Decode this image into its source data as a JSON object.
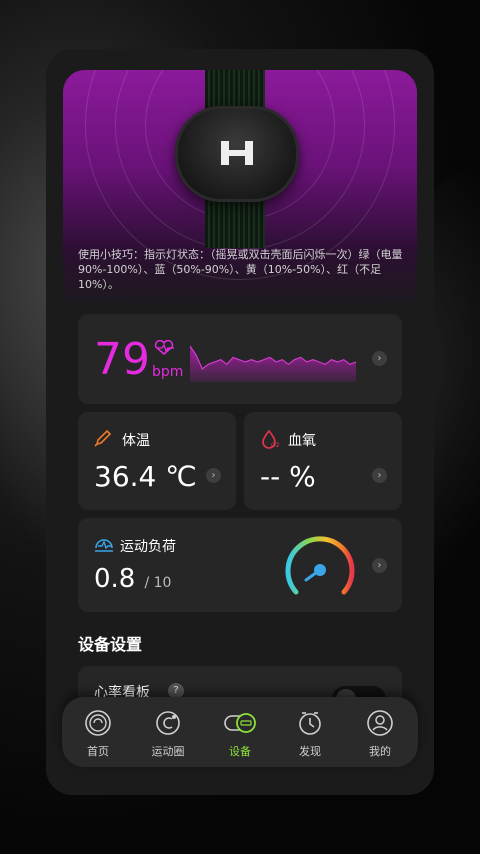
{
  "hero": {
    "tip": "使用小技巧：指示灯状态：（摇晃或双击壳面后闪烁一次）绿（电量90%-100%）、蓝（50%-90%）、黄（10%-50%）、红（不足10%）。"
  },
  "heart_rate": {
    "value": "79",
    "unit": "bpm",
    "color": "#e52be0",
    "trend_values": [
      70,
      66,
      60,
      62,
      63,
      64,
      62,
      65,
      64,
      63,
      64,
      63,
      64,
      65,
      63,
      64,
      62,
      64,
      65,
      63,
      64,
      63,
      62,
      64,
      63,
      64,
      62,
      63
    ]
  },
  "temperature": {
    "label": "体温",
    "value": "36.4 ℃"
  },
  "spo2": {
    "label": "血氧",
    "value": "-- %"
  },
  "training_load": {
    "label": "运动负荷",
    "value": "0.8",
    "max": "/ 10",
    "level": 0.08
  },
  "settings": {
    "section_title": "设备设置",
    "items": [
      {
        "label": "心率看板",
        "help": "?",
        "toggle_on": false
      }
    ]
  },
  "nav": {
    "active_color": "#8ce23a",
    "items": [
      {
        "label": "首页",
        "icon": "home-icon"
      },
      {
        "label": "运动圈",
        "icon": "sport-circle-icon"
      },
      {
        "label": "设备",
        "icon": "device-icon",
        "active": true
      },
      {
        "label": "发现",
        "icon": "discover-icon"
      },
      {
        "label": "我的",
        "icon": "profile-icon"
      }
    ]
  }
}
